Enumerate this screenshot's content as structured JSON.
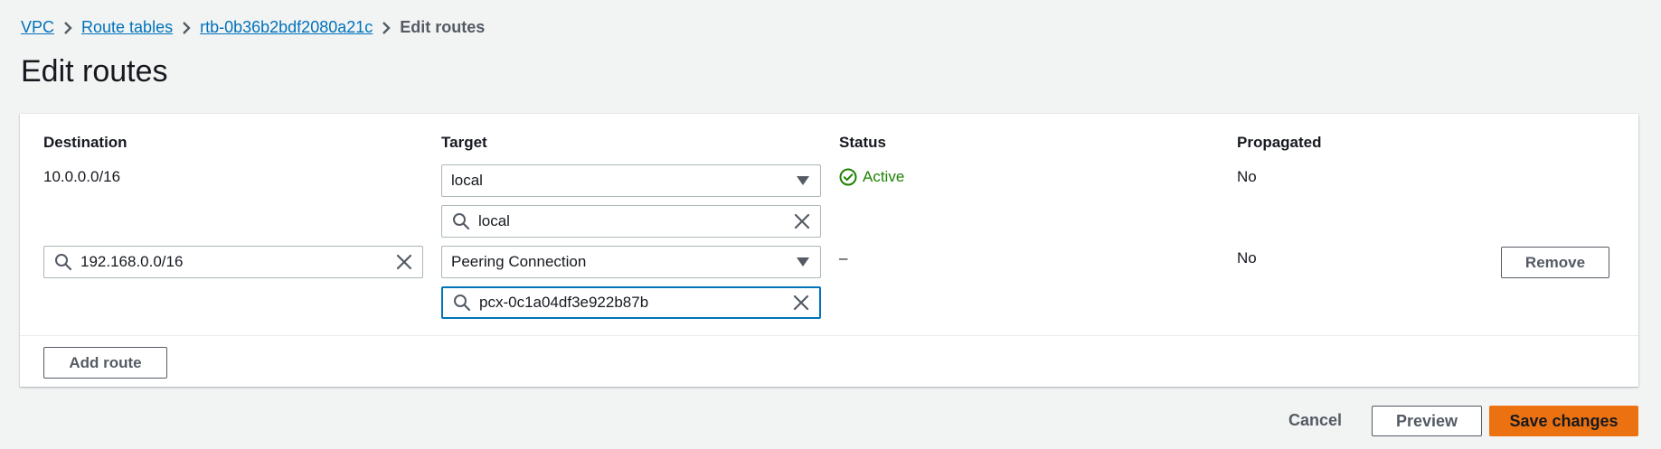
{
  "breadcrumb": {
    "items": [
      "VPC",
      "Route tables",
      "rtb-0b36b2bdf2080a21c"
    ],
    "current": "Edit routes"
  },
  "page_title": "Edit routes",
  "table": {
    "columns": [
      "Destination",
      "Target",
      "Status",
      "Propagated"
    ],
    "rows": [
      {
        "destination": "10.0.0.0/16",
        "target": "local",
        "target_search": "local",
        "status": "Active",
        "propagated": "No"
      },
      {
        "destination": "192.168.0.0/16",
        "target": "Peering Connection",
        "target_search": "pcx-0c1a04df3e922b87b",
        "status": "–",
        "propagated": "No",
        "remove_label": "Remove"
      }
    ]
  },
  "add_route_label": "Add route",
  "footer": {
    "cancel": "Cancel",
    "preview": "Preview",
    "save": "Save changes"
  },
  "colors": {
    "link": "#0073bb",
    "active": "#1d8102",
    "primary": "#ec7211",
    "focus": "#0073bb"
  }
}
